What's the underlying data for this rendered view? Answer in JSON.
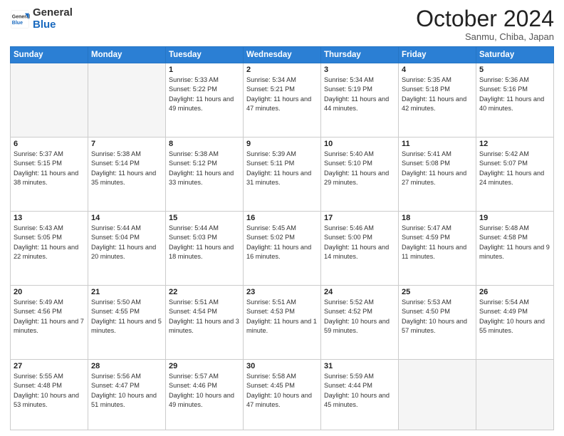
{
  "header": {
    "logo_general": "General",
    "logo_blue": "Blue",
    "month": "October 2024",
    "location": "Sanmu, Chiba, Japan"
  },
  "weekdays": [
    "Sunday",
    "Monday",
    "Tuesday",
    "Wednesday",
    "Thursday",
    "Friday",
    "Saturday"
  ],
  "weeks": [
    [
      {
        "day": null,
        "info": null
      },
      {
        "day": null,
        "info": null
      },
      {
        "day": "1",
        "sunrise": "5:33 AM",
        "sunset": "5:22 PM",
        "daylight": "11 hours and 49 minutes."
      },
      {
        "day": "2",
        "sunrise": "5:34 AM",
        "sunset": "5:21 PM",
        "daylight": "11 hours and 47 minutes."
      },
      {
        "day": "3",
        "sunrise": "5:34 AM",
        "sunset": "5:19 PM",
        "daylight": "11 hours and 44 minutes."
      },
      {
        "day": "4",
        "sunrise": "5:35 AM",
        "sunset": "5:18 PM",
        "daylight": "11 hours and 42 minutes."
      },
      {
        "day": "5",
        "sunrise": "5:36 AM",
        "sunset": "5:16 PM",
        "daylight": "11 hours and 40 minutes."
      }
    ],
    [
      {
        "day": "6",
        "sunrise": "5:37 AM",
        "sunset": "5:15 PM",
        "daylight": "11 hours and 38 minutes."
      },
      {
        "day": "7",
        "sunrise": "5:38 AM",
        "sunset": "5:14 PM",
        "daylight": "11 hours and 35 minutes."
      },
      {
        "day": "8",
        "sunrise": "5:38 AM",
        "sunset": "5:12 PM",
        "daylight": "11 hours and 33 minutes."
      },
      {
        "day": "9",
        "sunrise": "5:39 AM",
        "sunset": "5:11 PM",
        "daylight": "11 hours and 31 minutes."
      },
      {
        "day": "10",
        "sunrise": "5:40 AM",
        "sunset": "5:10 PM",
        "daylight": "11 hours and 29 minutes."
      },
      {
        "day": "11",
        "sunrise": "5:41 AM",
        "sunset": "5:08 PM",
        "daylight": "11 hours and 27 minutes."
      },
      {
        "day": "12",
        "sunrise": "5:42 AM",
        "sunset": "5:07 PM",
        "daylight": "11 hours and 24 minutes."
      }
    ],
    [
      {
        "day": "13",
        "sunrise": "5:43 AM",
        "sunset": "5:05 PM",
        "daylight": "11 hours and 22 minutes."
      },
      {
        "day": "14",
        "sunrise": "5:44 AM",
        "sunset": "5:04 PM",
        "daylight": "11 hours and 20 minutes."
      },
      {
        "day": "15",
        "sunrise": "5:44 AM",
        "sunset": "5:03 PM",
        "daylight": "11 hours and 18 minutes."
      },
      {
        "day": "16",
        "sunrise": "5:45 AM",
        "sunset": "5:02 PM",
        "daylight": "11 hours and 16 minutes."
      },
      {
        "day": "17",
        "sunrise": "5:46 AM",
        "sunset": "5:00 PM",
        "daylight": "11 hours and 14 minutes."
      },
      {
        "day": "18",
        "sunrise": "5:47 AM",
        "sunset": "4:59 PM",
        "daylight": "11 hours and 11 minutes."
      },
      {
        "day": "19",
        "sunrise": "5:48 AM",
        "sunset": "4:58 PM",
        "daylight": "11 hours and 9 minutes."
      }
    ],
    [
      {
        "day": "20",
        "sunrise": "5:49 AM",
        "sunset": "4:56 PM",
        "daylight": "11 hours and 7 minutes."
      },
      {
        "day": "21",
        "sunrise": "5:50 AM",
        "sunset": "4:55 PM",
        "daylight": "11 hours and 5 minutes."
      },
      {
        "day": "22",
        "sunrise": "5:51 AM",
        "sunset": "4:54 PM",
        "daylight": "11 hours and 3 minutes."
      },
      {
        "day": "23",
        "sunrise": "5:51 AM",
        "sunset": "4:53 PM",
        "daylight": "11 hours and 1 minute."
      },
      {
        "day": "24",
        "sunrise": "5:52 AM",
        "sunset": "4:52 PM",
        "daylight": "10 hours and 59 minutes."
      },
      {
        "day": "25",
        "sunrise": "5:53 AM",
        "sunset": "4:50 PM",
        "daylight": "10 hours and 57 minutes."
      },
      {
        "day": "26",
        "sunrise": "5:54 AM",
        "sunset": "4:49 PM",
        "daylight": "10 hours and 55 minutes."
      }
    ],
    [
      {
        "day": "27",
        "sunrise": "5:55 AM",
        "sunset": "4:48 PM",
        "daylight": "10 hours and 53 minutes."
      },
      {
        "day": "28",
        "sunrise": "5:56 AM",
        "sunset": "4:47 PM",
        "daylight": "10 hours and 51 minutes."
      },
      {
        "day": "29",
        "sunrise": "5:57 AM",
        "sunset": "4:46 PM",
        "daylight": "10 hours and 49 minutes."
      },
      {
        "day": "30",
        "sunrise": "5:58 AM",
        "sunset": "4:45 PM",
        "daylight": "10 hours and 47 minutes."
      },
      {
        "day": "31",
        "sunrise": "5:59 AM",
        "sunset": "4:44 PM",
        "daylight": "10 hours and 45 minutes."
      },
      {
        "day": null,
        "info": null
      },
      {
        "day": null,
        "info": null
      }
    ]
  ],
  "labels": {
    "sunrise": "Sunrise:",
    "sunset": "Sunset:",
    "daylight": "Daylight:"
  }
}
